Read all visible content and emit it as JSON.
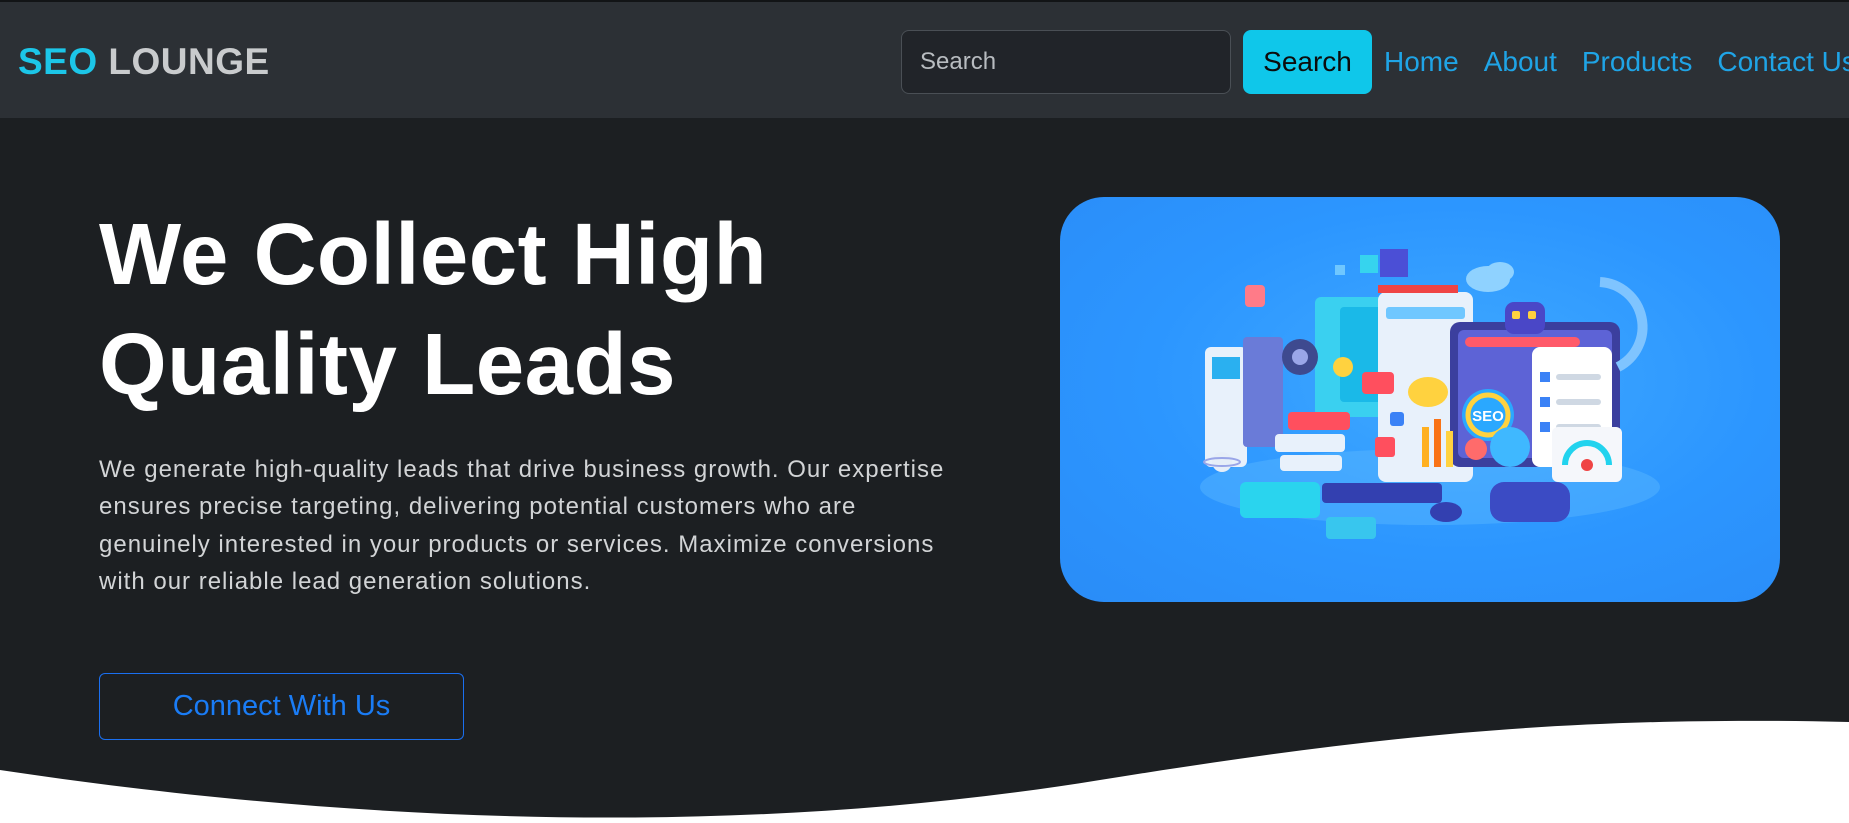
{
  "navbar": {
    "brand_part1": "SEO",
    "brand_part2": "LOUNGE",
    "search_placeholder": "Search",
    "search_button": "Search",
    "links": [
      "Home",
      "About",
      "Products",
      "Contact Us"
    ]
  },
  "hero": {
    "title": "We Collect High Quality Leads",
    "description": "We generate high-quality leads that drive business growth. Our expertise ensures precise targeting, delivering potential customers who are genuinely interested in your products or services. Maximize conversions with our reliable lead generation solutions.",
    "cta_label": "Connect With Us",
    "illustration_seo_text": "SEO"
  },
  "colors": {
    "accent_cyan": "#0fc7ea",
    "link_blue": "#1fa4e6",
    "cta_blue": "#1a6ff0",
    "background": "#1c1f22",
    "navbar": "#2c3035",
    "hero_image_bg": "#2c96ff"
  },
  "icons": {
    "hero_illustration": "seo-3d-illustration"
  }
}
